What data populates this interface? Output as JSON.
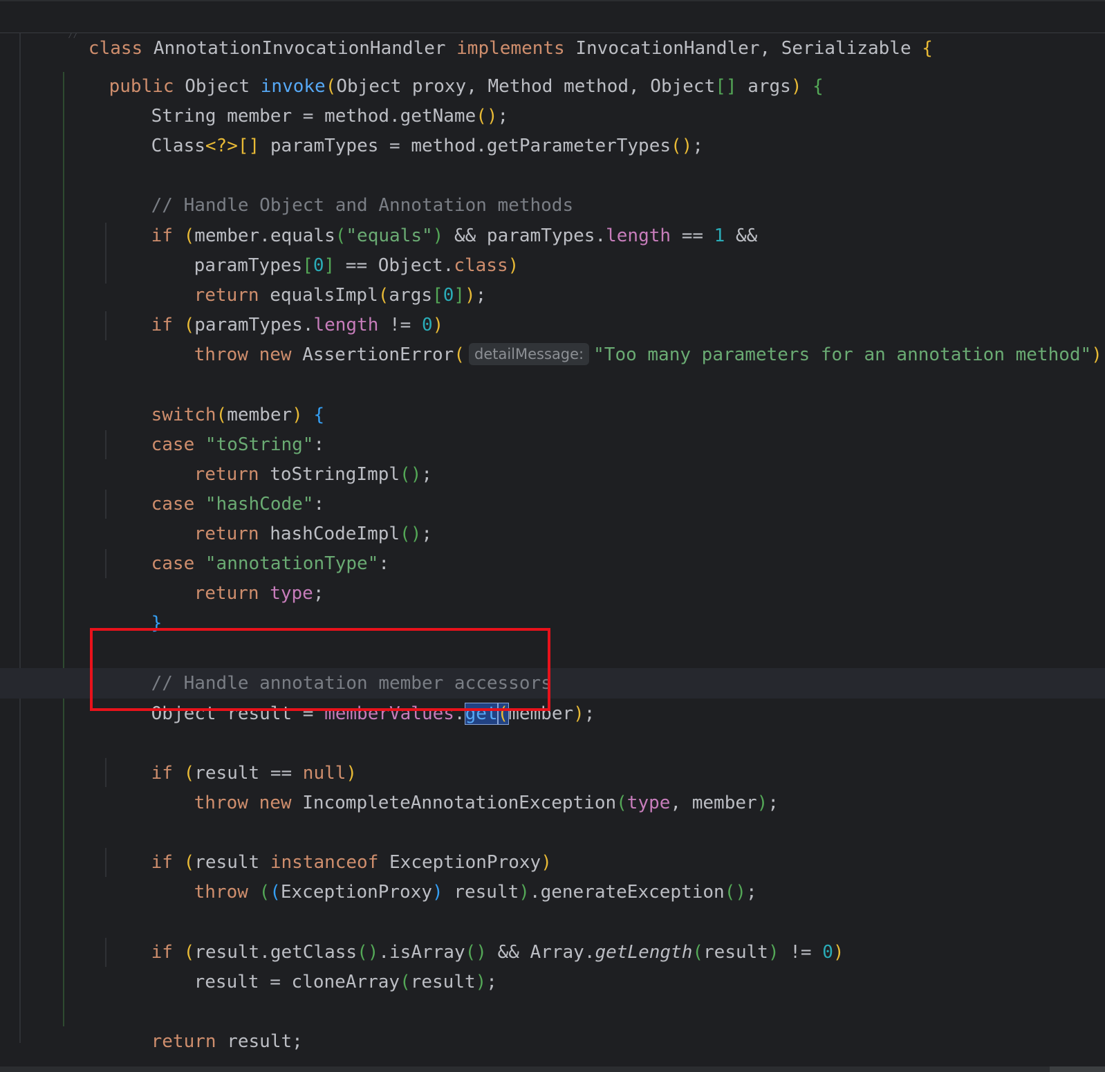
{
  "sticky_header": {
    "kw_class": "class",
    "class_name": "AnnotationInvocationHandler",
    "kw_implements": "implements",
    "interfaces": "InvocationHandler, Serializable",
    "brace": "{"
  },
  "hint": {
    "param_name": "detailMessage:"
  },
  "code": {
    "line1_kw": "public",
    "line1_type": "Object",
    "line1_fn": "invoke",
    "line1_params": "Object proxy, Method method, Object",
    "line1_args": "args",
    "line2": "String member = method.getName",
    "line3_type": "Class",
    "line3_generic": "<?>",
    "line3_rest": "paramTypes = method.getParameterTypes",
    "comment1": "// Handle Object and Annotation methods",
    "if_kw": "if",
    "equals_call": "member.equals",
    "equals_str": "\"equals\"",
    "and_op": "&&",
    "paramtypes": "paramTypes",
    "length_field": "length",
    "eq_op": "==",
    "num_one": "1",
    "num_zero": "0",
    "object_class_obj": "Object.",
    "class_kw": "class",
    "return_kw": "return",
    "equalsimpl": "equalsImpl",
    "args": "args",
    "neq_op": "!=",
    "throw_kw": "throw",
    "new_kw": "new",
    "assertion_error": "AssertionError",
    "too_many_str": "\"Too many parameters for an annotation method\"",
    "switch_kw": "switch",
    "member": "member",
    "case_kw": "case",
    "tostring_str": "\"toString\"",
    "tostringimpl": "toStringImpl",
    "hashcode_str": "\"hashCode\"",
    "hashcodeimpl": "hashCodeImpl",
    "annotationtype_str": "\"annotationType\"",
    "type_field": "type",
    "comment2": "// Handle annotation member accessors",
    "object_result": "Object result = ",
    "membervalues": "memberValues",
    "get_fn": "get",
    "result": "result",
    "null_kw": "null",
    "incomplete_exc": "IncompleteAnnotationException",
    "instanceof_kw": "instanceof",
    "exception_proxy": "ExceptionProxy",
    "generate_exc": ".generateException",
    "getclass": "result.getClass",
    "isarray": ".isArray",
    "array_obj": "Array.",
    "getlength": "getLength",
    "clonearray": "cloneArray",
    "result_assign": "result = ",
    "return_result": "result;",
    "close_brace": "}"
  },
  "colors": {
    "background": "#1e1f22",
    "keyword": "#cf8e6d",
    "function": "#56a8f5",
    "string": "#6aab73",
    "number": "#2aacb8",
    "field": "#c77dbb",
    "comment": "#7a7e85",
    "highlight_box": "#e8121b"
  }
}
